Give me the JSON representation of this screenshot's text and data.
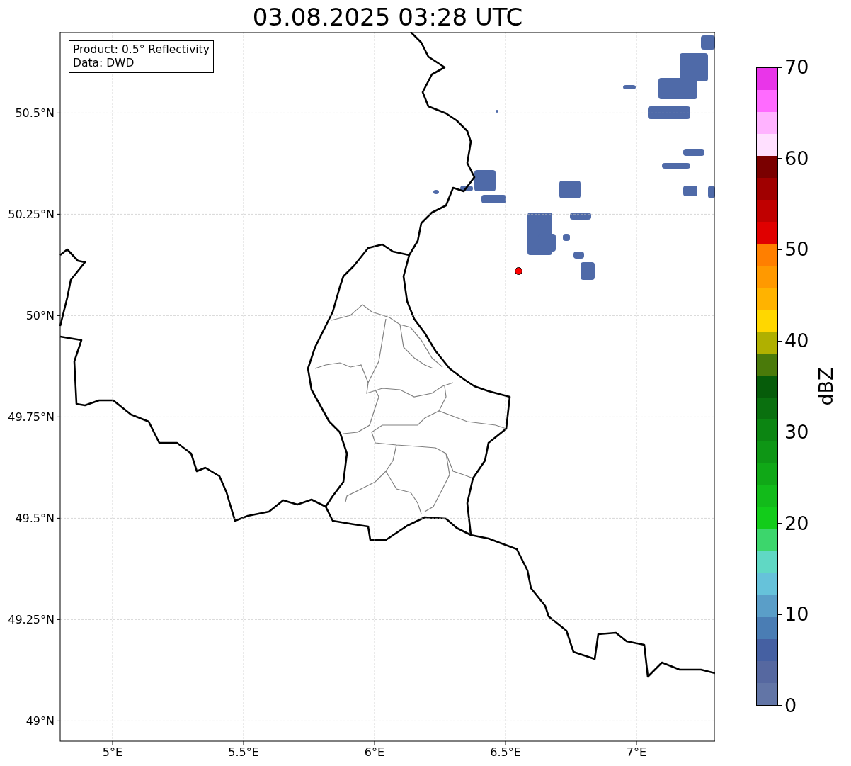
{
  "chart_data": {
    "type": "scatter",
    "title": "03.08.2025 03:28 UTC",
    "grid": true,
    "xlim": [
      4.8,
      7.3
    ],
    "ylim": [
      48.95,
      50.7
    ],
    "xticks": [
      {
        "value": 5,
        "label": "5°E"
      },
      {
        "value": 5.5,
        "label": "5.5°E"
      },
      {
        "value": 6,
        "label": "6°E"
      },
      {
        "value": 6.5,
        "label": "6.5°E"
      },
      {
        "value": 7,
        "label": "7°E"
      }
    ],
    "yticks": [
      {
        "value": 49,
        "label": "49°N"
      },
      {
        "value": 49.25,
        "label": "49.25°N"
      },
      {
        "value": 49.5,
        "label": "49.5°N"
      },
      {
        "value": 49.75,
        "label": "49.75°N"
      },
      {
        "value": 50,
        "label": "50°N"
      },
      {
        "value": 50.25,
        "label": "50.25°N"
      },
      {
        "value": 50.5,
        "label": "50.5°N"
      }
    ],
    "x": [
      6.55
    ],
    "series": [
      {
        "color": "#ff0000",
        "values": [
          50.11
        ]
      }
    ]
  },
  "legend": {
    "lines": [
      "Product: 0.5° Reflectivity",
      "Data: DWD"
    ]
  },
  "colorbar": {
    "label": "dBZ",
    "ticks": [
      "70",
      "60",
      "50",
      "40",
      "30",
      "20",
      "10",
      "0"
    ],
    "bands": [
      {
        "color": "#e935e9"
      },
      {
        "color": "#ff6bff"
      },
      {
        "color": "#ffb3ff"
      },
      {
        "color": "#ffe0ff"
      },
      {
        "color": "#7a0000"
      },
      {
        "color": "#a00000"
      },
      {
        "color": "#c00000"
      },
      {
        "color": "#e00000"
      },
      {
        "color": "#ff7f00"
      },
      {
        "color": "#ff9900"
      },
      {
        "color": "#ffb300"
      },
      {
        "color": "#ffd700"
      },
      {
        "color": "#b0b000"
      },
      {
        "color": "#4a7a0a"
      },
      {
        "color": "#065c0a"
      },
      {
        "color": "#0a700f"
      },
      {
        "color": "#0c8512"
      },
      {
        "color": "#0e9615"
      },
      {
        "color": "#10a817"
      },
      {
        "color": "#12bb1a"
      },
      {
        "color": "#12cc1a"
      },
      {
        "color": "#3cd66c"
      },
      {
        "color": "#60d8c4"
      },
      {
        "color": "#66c2da"
      },
      {
        "color": "#5a9ec8"
      },
      {
        "color": "#4a7db4"
      },
      {
        "color": "#4560a2"
      },
      {
        "color": "#5668a0"
      },
      {
        "color": "#6275a6"
      }
    ]
  }
}
